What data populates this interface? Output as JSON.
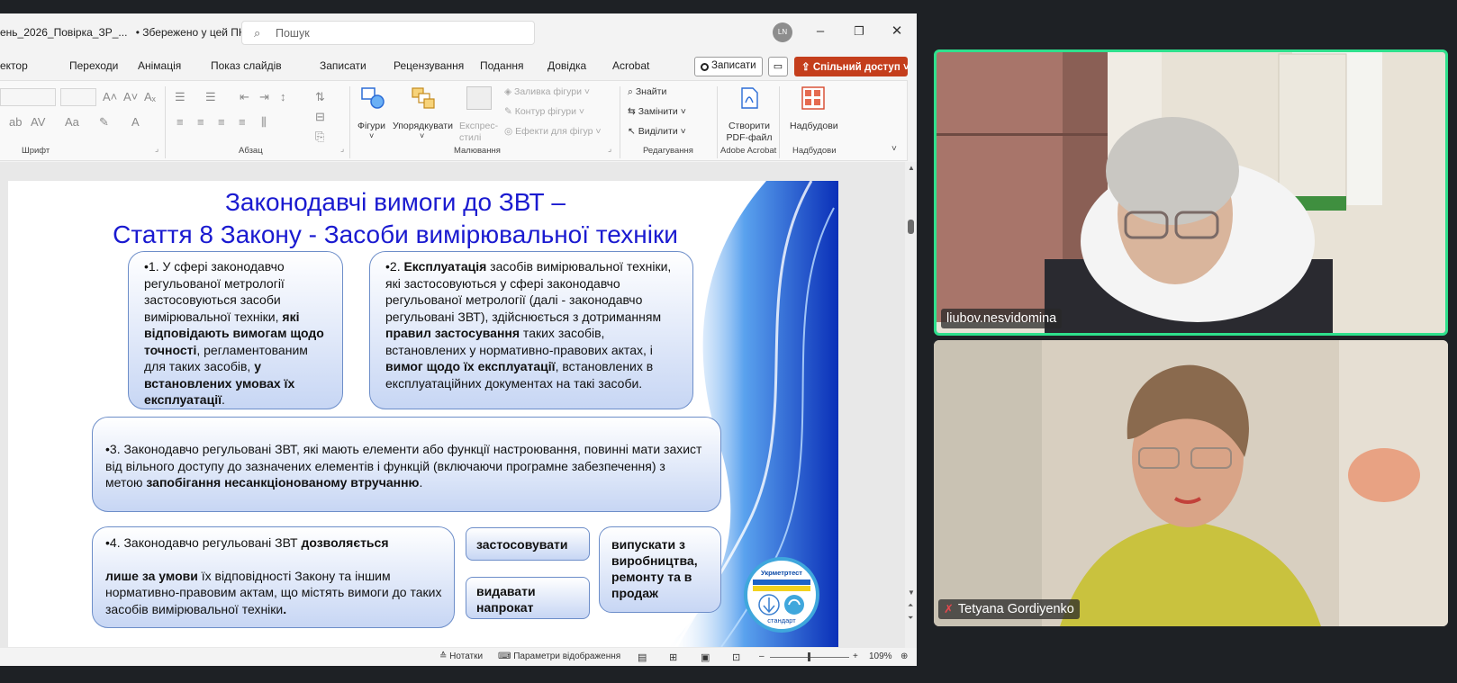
{
  "powerpoint": {
    "title_bar": {
      "doc_title": "ень_2026_Повірка_ЗР_...",
      "save_status": "• Збережено у цей ПК",
      "search_placeholder": "Пошук",
      "user_initials": "LN"
    },
    "ribbon_tabs": [
      "ектор",
      "Переходи",
      "Анімація",
      "Показ слайдів",
      "Записати",
      "Рецензування",
      "Подання",
      "Довідка",
      "Acrobat"
    ],
    "record_label": "Записати",
    "share_label": "Спільний доступ",
    "ribbon": {
      "groups": [
        "Шрифт",
        "Абзац",
        "Малювання",
        "Редагування",
        "Adobe Acrobat",
        "Надбудови"
      ],
      "drawing": {
        "shapes": "Фігури",
        "arrange": "Упорядкувати",
        "quick_styles": "Експрес-стилі",
        "fill": "Заливка фігури",
        "outline": "Контур фігури",
        "effects": "Ефекти для фігур"
      },
      "editing": {
        "find": "Знайти",
        "replace": "Замінити",
        "select": "Виділити"
      },
      "acrobat": {
        "create_pdf": "Створити PDF-файл"
      },
      "addins": {
        "addins_label": "Надбудови"
      }
    },
    "slide": {
      "title_line1": "Законодавчі вимоги до ЗВТ –",
      "title_line2": "Стаття 8 Закону - Засоби вимірювальної техніки",
      "box1": {
        "text_a": "•1. У сфері законодавчо регульованої метрології застосовуються засоби вимірювальної техніки, ",
        "bold_a": "які відповідають вимогам щодо точності",
        "text_b": ", регламентованим для таких засобів, ",
        "bold_b": "у встановлених умовах їх експлуатації",
        "text_c": "."
      },
      "box2": {
        "text_a": "•2. ",
        "bold_a": "Експлуатація",
        "text_b": " засобів вимірювальної техніки, які застосовуються у сфері законодавчо регульованої метрології (далі - законодавчо регульовані ЗВТ), здійснюється з дотриманням ",
        "bold_b": "правил застосування",
        "text_c": " таких засобів, встановлених у нормативно-правових актах, і ",
        "bold_c": "вимог щодо їх експлуатації",
        "text_d": ", встановлених в експлуатаційних документах на такі засоби."
      },
      "box3": {
        "text_a": "•3. Законодавчо регульовані ЗВТ, які мають елементи або функції настроювання, повинні мати захист від вільного доступу до зазначених елементів і функцій (включаючи програмне забезпечення) з метою ",
        "bold_a": "запобігання несанкціонованому втручанню",
        "text_b": "."
      },
      "box4": {
        "text_a": "•4. Законодавчо регульовані ЗВТ ",
        "bold_a": "дозволяється",
        "bold_b": "лише за умови",
        "text_b": " їх відповідності Закону та іншим нормативно-правовим актам,  що містять вимоги до таких засобів вимірювальної техніки",
        "text_c": "."
      },
      "opt_use": "застосовувати",
      "opt_rent": "видавати напрокат",
      "opt_release": "випускати з виробництва, ремонту та в продаж",
      "logo_top": "Укрметртест",
      "logo_bottom": "стандарт"
    },
    "status_bar": {
      "notes": "Нотатки",
      "display_settings": "Параметри відображення",
      "zoom": "109%"
    }
  },
  "participants": [
    {
      "name": "liubov.nesvidomina",
      "active_speaker": true,
      "muted": false
    },
    {
      "name": "Tetyana Gordiyenko",
      "active_speaker": false,
      "muted": true
    }
  ],
  "colors": {
    "slide_title": "#1a1ad0",
    "share_button": "#c43e1c",
    "active_speaker_border": "#2fe08d",
    "muted_icon": "#e5484d"
  }
}
